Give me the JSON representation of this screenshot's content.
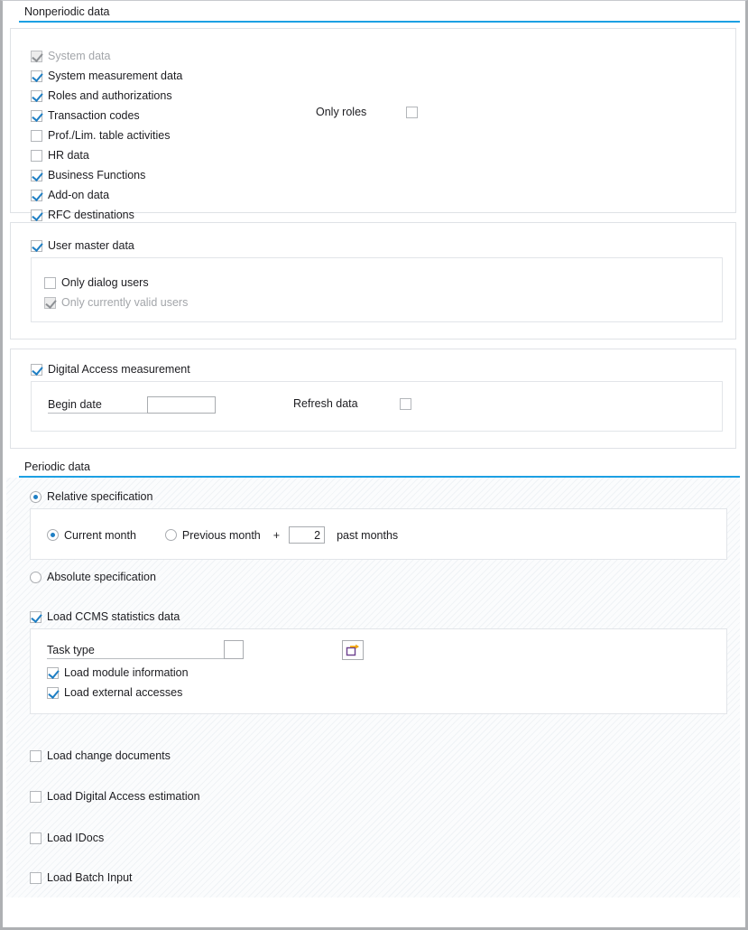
{
  "sections": {
    "nonperiodic": {
      "title": "Nonperiodic data",
      "checkboxes": [
        {
          "label": "System data",
          "checked": true,
          "disabled": true
        },
        {
          "label": "System measurement data",
          "checked": true,
          "disabled": false
        },
        {
          "label": "Roles and authorizations",
          "checked": true,
          "disabled": false
        },
        {
          "label": "Transaction codes",
          "checked": true,
          "disabled": false
        },
        {
          "label": "Prof./Lim. table activities",
          "checked": false,
          "disabled": false
        },
        {
          "label": "HR data",
          "checked": false,
          "disabled": false
        },
        {
          "label": "Business Functions",
          "checked": true,
          "disabled": false
        },
        {
          "label": "Add-on data",
          "checked": true,
          "disabled": false
        },
        {
          "label": "RFC destinations",
          "checked": true,
          "disabled": false
        }
      ],
      "only_roles": {
        "label": "Only roles",
        "checked": false
      },
      "user_master": {
        "label": "User master data",
        "checked": true,
        "children": [
          {
            "label": "Only dialog users",
            "checked": false,
            "disabled": false
          },
          {
            "label": "Only currently valid users",
            "checked": true,
            "disabled": true
          }
        ]
      },
      "digital_access": {
        "label": "Digital Access measurement",
        "checked": true,
        "begin_date_label": "Begin date",
        "begin_date_value": "",
        "begin_date_placeholder": "",
        "refresh_label": "Refresh data",
        "refresh_checked": false
      }
    },
    "periodic": {
      "title": "Periodic data",
      "relative": {
        "label": "Relative specification",
        "selected": true
      },
      "current_month": {
        "label": "Current month",
        "selected": true
      },
      "previous_month": {
        "label": "Previous month",
        "selected": false
      },
      "plus_sign": "+",
      "past_months_value": "2",
      "past_months_label": "past months",
      "absolute": {
        "label": "Absolute specification",
        "selected": false
      },
      "ccms": {
        "label": "Load CCMS statistics data",
        "checked": true,
        "task_type_label": "Task type",
        "task_type_value": "",
        "multi_select_icon": "multiple-selection-icon",
        "children": [
          {
            "label": "Load module information",
            "checked": true
          },
          {
            "label": "Load external accesses",
            "checked": true
          }
        ]
      },
      "tail_checkboxes": [
        {
          "label": "Load change documents",
          "checked": false
        },
        {
          "label": "Load Digital Access estimation",
          "checked": false
        },
        {
          "label": "Load IDocs",
          "checked": false
        },
        {
          "label": "Load Batch Input",
          "checked": false
        }
      ]
    }
  },
  "colors": {
    "accent": "#1ca0e3",
    "check": "#1f7fc4",
    "icon_arrow": "#f0a30a",
    "icon_box": "#6b3f8e"
  }
}
